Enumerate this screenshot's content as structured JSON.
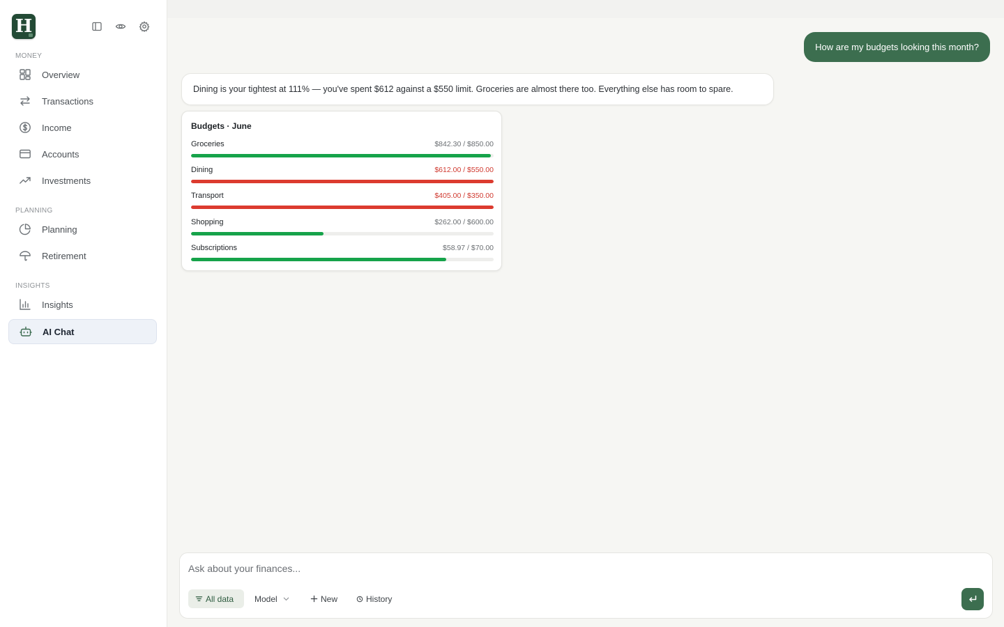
{
  "app": {
    "logo_letter": "H"
  },
  "sidebar": {
    "sections": [
      {
        "label": "MONEY",
        "items": [
          {
            "label": "Overview",
            "icon": "grid-icon"
          },
          {
            "label": "Transactions",
            "icon": "arrows-icon"
          },
          {
            "label": "Income",
            "icon": "dollar-icon"
          },
          {
            "label": "Accounts",
            "icon": "card-icon"
          },
          {
            "label": "Investments",
            "icon": "trend-icon"
          }
        ]
      },
      {
        "label": "PLANNING",
        "items": [
          {
            "label": "Planning",
            "icon": "pie-icon"
          },
          {
            "label": "Retirement",
            "icon": "umbrella-icon"
          }
        ]
      },
      {
        "label": "INSIGHTS",
        "items": [
          {
            "label": "Insights",
            "icon": "bar-chart-icon"
          },
          {
            "label": "AI Chat",
            "icon": "bot-icon",
            "active": true
          }
        ]
      }
    ]
  },
  "chat": {
    "user_message": "How are my budgets looking this month?",
    "ai_message": "Dining is your tightest at 111% — you've spent $612 against a $550 limit. Groceries are almost there too. Everything else has room to spare."
  },
  "budget_card": {
    "title": "Budgets · June",
    "rows": [
      {
        "name": "Groceries",
        "amount": "$842.30 / $850.00",
        "spent": 842.3,
        "limit": 850.0,
        "over": false
      },
      {
        "name": "Dining",
        "amount": "$612.00 / $550.00",
        "spent": 612.0,
        "limit": 550.0,
        "over": true
      },
      {
        "name": "Transport",
        "amount": "$405.00 / $350.00",
        "spent": 405.0,
        "limit": 350.0,
        "over": true
      },
      {
        "name": "Shopping",
        "amount": "$262.00 / $600.00",
        "spent": 262.0,
        "limit": 600.0,
        "over": false
      },
      {
        "name": "Subscriptions",
        "amount": "$58.97 / $70.00",
        "spent": 58.97,
        "limit": 70.0,
        "over": false
      }
    ]
  },
  "composer": {
    "placeholder": "Ask about your finances...",
    "filter_label": "All data",
    "model_label": "Model",
    "new_label": "New",
    "history_label": "History"
  },
  "colors": {
    "accent": "#3c6e4f",
    "ok_bar": "#16a34a",
    "over_bar": "#dc3b2f",
    "over_text": "#d0392f"
  }
}
